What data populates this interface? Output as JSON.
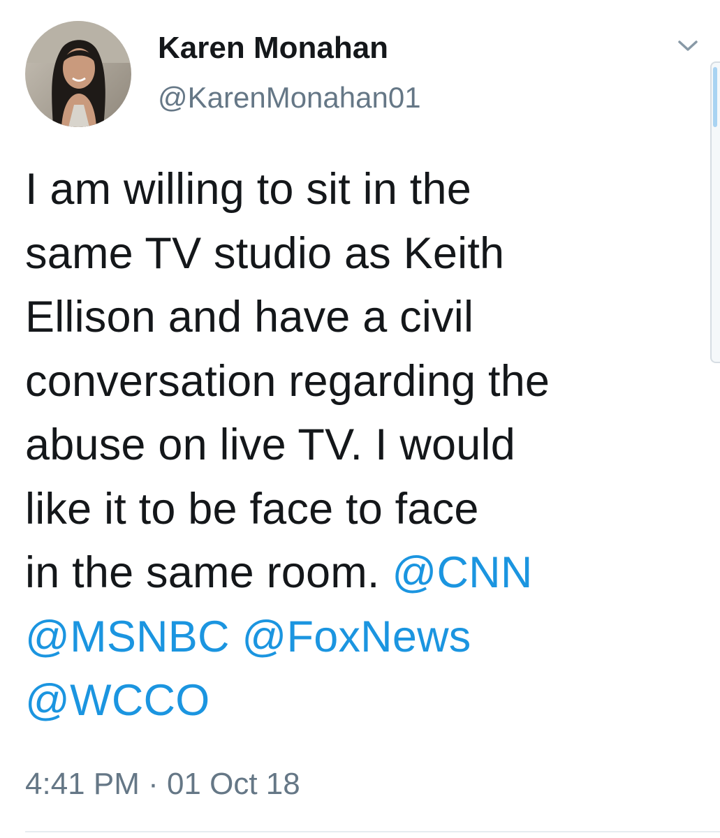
{
  "tweet": {
    "author": {
      "display_name": "Karen Monahan",
      "handle": "@KarenMonahan01",
      "avatar_icon": "profile-photo"
    },
    "menu_icon": "chevron-down-icon",
    "text_lines": [
      [
        "I am willing to sit in the"
      ],
      [
        "same TV studio as Keith"
      ],
      [
        "Ellison and have a civil"
      ],
      [
        "conversation regarding the"
      ],
      [
        "abuse on live TV. I would"
      ],
      [
        "like it to be face to face"
      ],
      [
        "in the same room. ",
        "@CNN"
      ],
      [
        "@MSNBC",
        " ",
        "@FoxNews"
      ],
      [
        "@WCCO"
      ]
    ],
    "mentions": [
      "@CNN",
      "@MSNBC",
      "@FoxNews",
      "@WCCO"
    ],
    "timestamp": "4:41 PM · 01 Oct 18"
  },
  "colors": {
    "text": "#14171a",
    "secondary": "#657786",
    "link": "#1b95e0",
    "divider": "#e6ecf0"
  }
}
